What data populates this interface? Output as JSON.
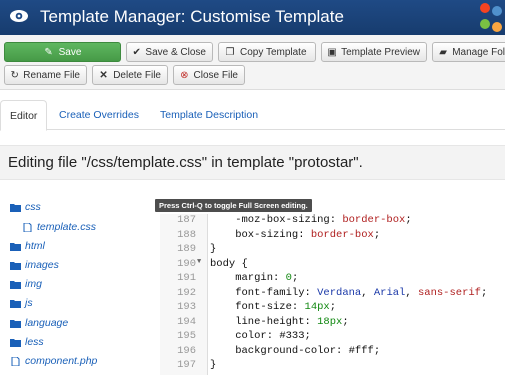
{
  "header": {
    "title": "Template Manager: Customise Template"
  },
  "toolbar": {
    "save": "Save",
    "save_close": "Save & Close",
    "copy_template": "Copy Template",
    "template_preview": "Template Preview",
    "manage_folders": "Manage Fol",
    "rename_file": "Rename File",
    "delete_file": "Delete File",
    "close_file": "Close File"
  },
  "tabs": [
    {
      "label": "Editor"
    },
    {
      "label": "Create Overrides"
    },
    {
      "label": "Template Description"
    }
  ],
  "banner": {
    "text": "Editing file \"/css/template.css\" in template \"protostar\"."
  },
  "tooltip": "Press Ctrl-Q to toggle Full Screen editing.",
  "tree": [
    {
      "label": "css",
      "type": "folder",
      "depth": 0
    },
    {
      "label": "template.css",
      "type": "file",
      "depth": 1
    },
    {
      "label": "html",
      "type": "folder",
      "depth": 0
    },
    {
      "label": "images",
      "type": "folder",
      "depth": 0
    },
    {
      "label": "img",
      "type": "folder",
      "depth": 0
    },
    {
      "label": "js",
      "type": "folder",
      "depth": 0
    },
    {
      "label": "language",
      "type": "folder",
      "depth": 0
    },
    {
      "label": "less",
      "type": "folder",
      "depth": 0
    },
    {
      "label": "component.php",
      "type": "file",
      "depth": 0
    }
  ],
  "code": [
    {
      "line": "187",
      "fold": "",
      "parts": [
        [
          "",
          "    -moz-box-sizing: "
        ],
        [
          "val",
          "border-box"
        ],
        [
          "",
          ";"
        ]
      ]
    },
    {
      "line": "188",
      "fold": "",
      "parts": [
        [
          "",
          "    box-sizing: "
        ],
        [
          "val",
          "border-box"
        ],
        [
          "",
          ";"
        ]
      ]
    },
    {
      "line": "189",
      "fold": "",
      "parts": [
        [
          "",
          "}"
        ]
      ]
    },
    {
      "line": "190",
      "fold": "▼",
      "parts": [
        [
          "",
          "body {"
        ]
      ]
    },
    {
      "line": "191",
      "fold": "",
      "parts": [
        [
          "",
          "    margin: "
        ],
        [
          "num",
          "0"
        ],
        [
          "",
          ";"
        ]
      ]
    },
    {
      "line": "192",
      "fold": "",
      "parts": [
        [
          "",
          "    font-family: "
        ],
        [
          "blue",
          "Verdana"
        ],
        [
          "",
          ", "
        ],
        [
          "blue",
          "Arial"
        ],
        [
          "",
          ", "
        ],
        [
          "val",
          "sans-serif"
        ],
        [
          "",
          ";"
        ]
      ]
    },
    {
      "line": "193",
      "fold": "",
      "parts": [
        [
          "",
          "    font-size: "
        ],
        [
          "num",
          "14px"
        ],
        [
          "",
          ";"
        ]
      ]
    },
    {
      "line": "194",
      "fold": "",
      "parts": [
        [
          "",
          "    line-height: "
        ],
        [
          "num",
          "18px"
        ],
        [
          "",
          ";"
        ]
      ]
    },
    {
      "line": "195",
      "fold": "",
      "parts": [
        [
          "",
          "    color: "
        ],
        [
          "sel",
          "#333"
        ],
        [
          "",
          ";"
        ]
      ]
    },
    {
      "line": "196",
      "fold": "",
      "parts": [
        [
          "",
          "    background-color: "
        ],
        [
          "sel",
          "#fff"
        ],
        [
          "",
          ";"
        ]
      ]
    },
    {
      "line": "197",
      "fold": "",
      "parts": [
        [
          "",
          "}"
        ]
      ]
    }
  ],
  "colors": {
    "header_bg": "#1f4a85",
    "save_green": "#4fa950",
    "link_blue": "#1a60b8",
    "css_value_red": "#b02020",
    "css_number_green": "#118811"
  }
}
